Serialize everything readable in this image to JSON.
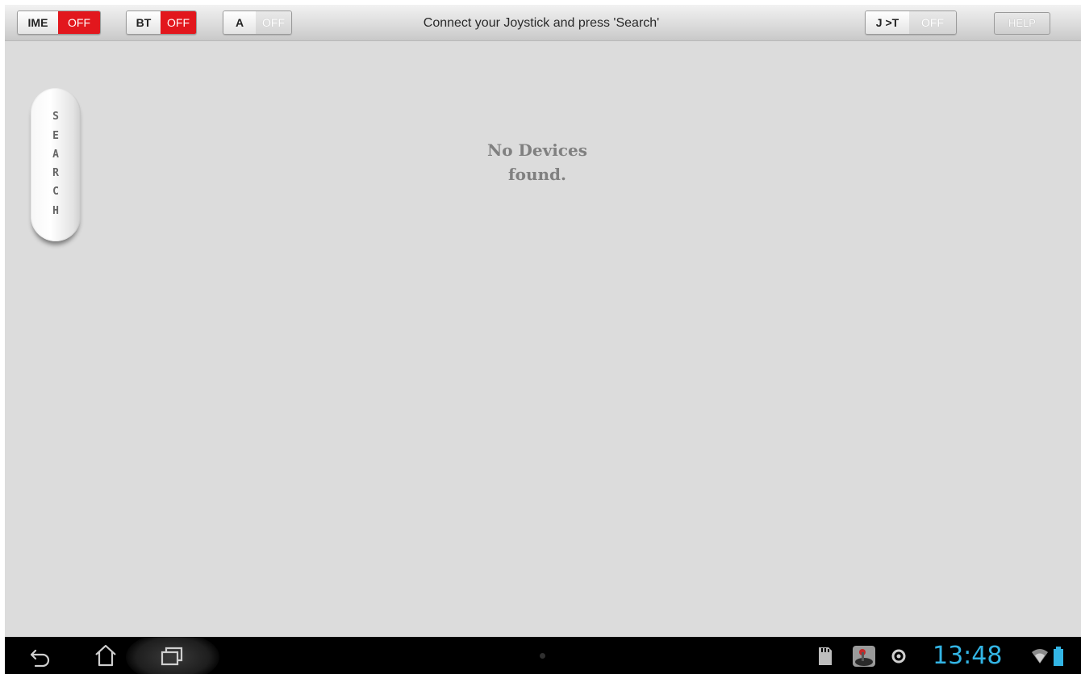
{
  "toolbar": {
    "ime": {
      "label": "IME",
      "state": "OFF"
    },
    "bt": {
      "label": "BT",
      "state": "OFF"
    },
    "a": {
      "label": "A",
      "state": "OFF"
    },
    "message": "Connect your Joystick and press 'Search'",
    "jt": {
      "label": "J >T",
      "state": "OFF"
    },
    "help_label": "HELP"
  },
  "search_button": {
    "letters": [
      "S",
      "E",
      "A",
      "R",
      "C",
      "H"
    ]
  },
  "main": {
    "line1": "No Devices",
    "line2": "found."
  },
  "status_bar": {
    "time": "13:48"
  },
  "icons": {
    "back": "back-icon",
    "home": "home-icon",
    "recents": "recent-apps-icon",
    "sd": "sd-card-icon",
    "app": "app-notification-icon",
    "sync": "sync-icon",
    "wifi": "wifi-icon",
    "battery": "battery-icon"
  },
  "colors": {
    "red_off": "#e2171d",
    "clock": "#33b5e5"
  }
}
